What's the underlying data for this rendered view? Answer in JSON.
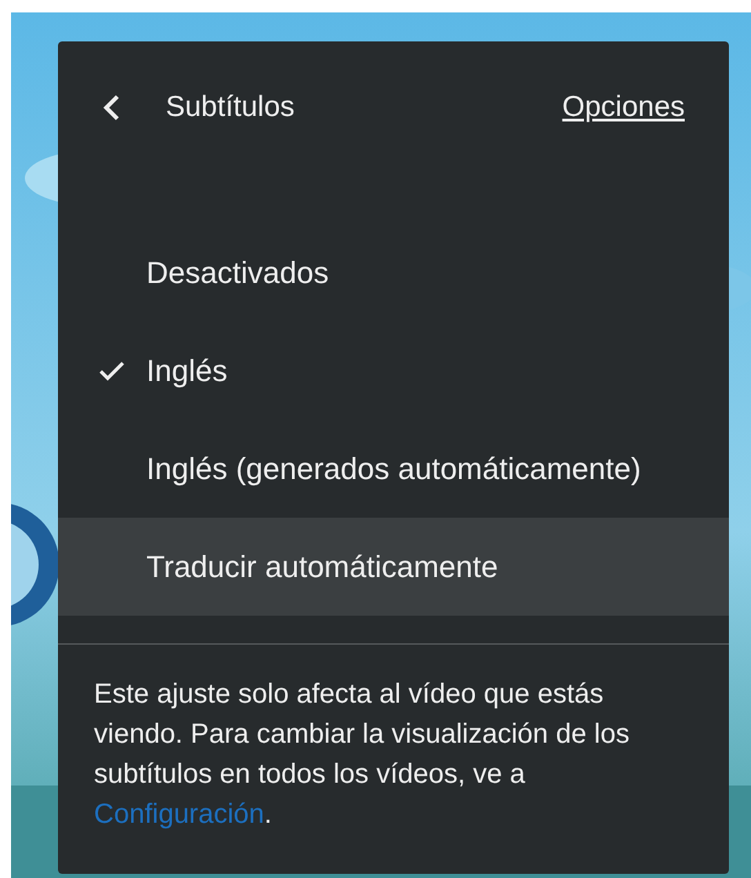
{
  "menu": {
    "title": "Subtítulos",
    "options_link": "Opciones",
    "items": [
      {
        "label": "Desactivados",
        "selected": false,
        "highlighted": false
      },
      {
        "label": "Inglés",
        "selected": true,
        "highlighted": false
      },
      {
        "label": "Inglés (generados automáticamente)",
        "selected": false,
        "highlighted": false
      },
      {
        "label": "Traducir automáticamente",
        "selected": false,
        "highlighted": true
      }
    ],
    "note": "Este ajuste solo afecta al vídeo que estás viendo. Para cambiar la visualización de los subtítulos en todos los vídeos, ve a",
    "note_link": "Configuración",
    "note_end": "."
  }
}
